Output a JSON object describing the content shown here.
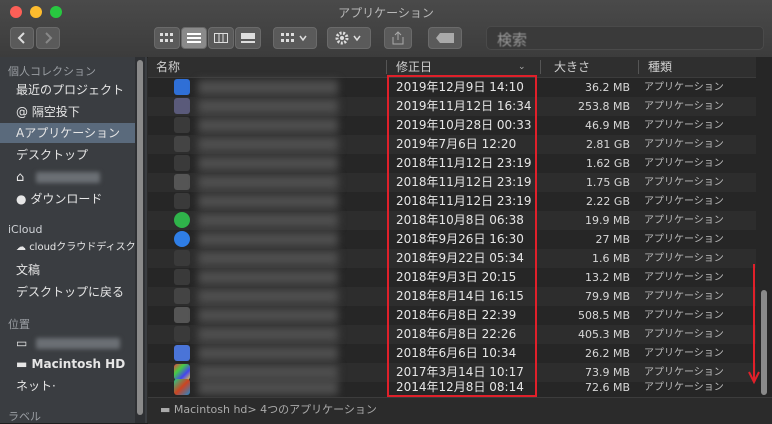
{
  "window": {
    "title": "アプリケーション"
  },
  "toolbar": {
    "back_icon": "chevron-left-icon",
    "forward_icon": "chevron-right-icon",
    "search_placeholder": "検索"
  },
  "sidebar": {
    "sections": [
      {
        "label": "個人コレクション"
      },
      {
        "label": "iCloud"
      },
      {
        "label": "位置"
      },
      {
        "label": "ラベル"
      }
    ],
    "items": [
      {
        "label": "最近のプロジェクト"
      },
      {
        "label": "@ 隔空投下"
      },
      {
        "label": "Aアプリケーション"
      },
      {
        "label": "デスクトップ"
      },
      {
        "label": ""
      },
      {
        "label": "ダウンロード"
      },
      {
        "label": "cloudクラウドディスク"
      },
      {
        "label": "文稿"
      },
      {
        "label": "デスクトップに戻る"
      },
      {
        "label": ""
      },
      {
        "label": "Macintosh HD"
      },
      {
        "label": "ネット·"
      }
    ]
  },
  "columns": {
    "name": "名称",
    "date": "修正日",
    "size": "大きさ",
    "kind": "種類"
  },
  "rows": [
    {
      "date": "2019年12月9日 14:10",
      "size": "36.2 MB",
      "kind": "アプリケーション"
    },
    {
      "date": "2019年11月12日 16:34",
      "size": "253.8 MB",
      "kind": "アプリケーション"
    },
    {
      "date": "2019年10月28日 00:33",
      "size": "46.9 MB",
      "kind": "アプリケーション"
    },
    {
      "date": "2019年7月6日 12:20",
      "size": "2.81 GB",
      "kind": "アプリケーション"
    },
    {
      "date": "2018年11月12日 23:19",
      "size": "1.62 GB",
      "kind": "アプリケーション"
    },
    {
      "date": "2018年11月12日 23:19",
      "size": "1.75 GB",
      "kind": "アプリケーション"
    },
    {
      "date": "2018年11月12日 23:19",
      "size": "2.22 GB",
      "kind": "アプリケーション"
    },
    {
      "date": "2018年10月8日 06:38",
      "size": "19.9 MB",
      "kind": "アプリケーション"
    },
    {
      "date": "2018年9月26日 16:30",
      "size": "27 MB",
      "kind": "アプリケーション"
    },
    {
      "date": "2018年9月22日 05:34",
      "size": "1.6 MB",
      "kind": "アプリケーション"
    },
    {
      "date": "2018年9月3日 20:15",
      "size": "13.2 MB",
      "kind": "アプリケーション"
    },
    {
      "date": "2018年8月14日 16:15",
      "size": "79.9 MB",
      "kind": "アプリケーション"
    },
    {
      "date": "2018年6月8日 22:39",
      "size": "508.5 MB",
      "kind": "アプリケーション"
    },
    {
      "date": "2018年6月8日 22:26",
      "size": "405.3 MB",
      "kind": "アプリケーション"
    },
    {
      "date": "2018年6月6日 10:34",
      "size": "26.2 MB",
      "kind": "アプリケーション"
    },
    {
      "date": "2017年3月14日 10:17",
      "size": "73.9 MB",
      "kind": "アプリケーション"
    },
    {
      "date": "2014年12月8日 08:14",
      "size": "72.6 MB",
      "kind": "アプリケーション"
    }
  ],
  "pathbar": {
    "text": "Macintosh hd> 4つのアプリケーション"
  },
  "colors": {
    "highlight_box": "#e0202a",
    "selected_sidebar": "#5a6a7c"
  }
}
